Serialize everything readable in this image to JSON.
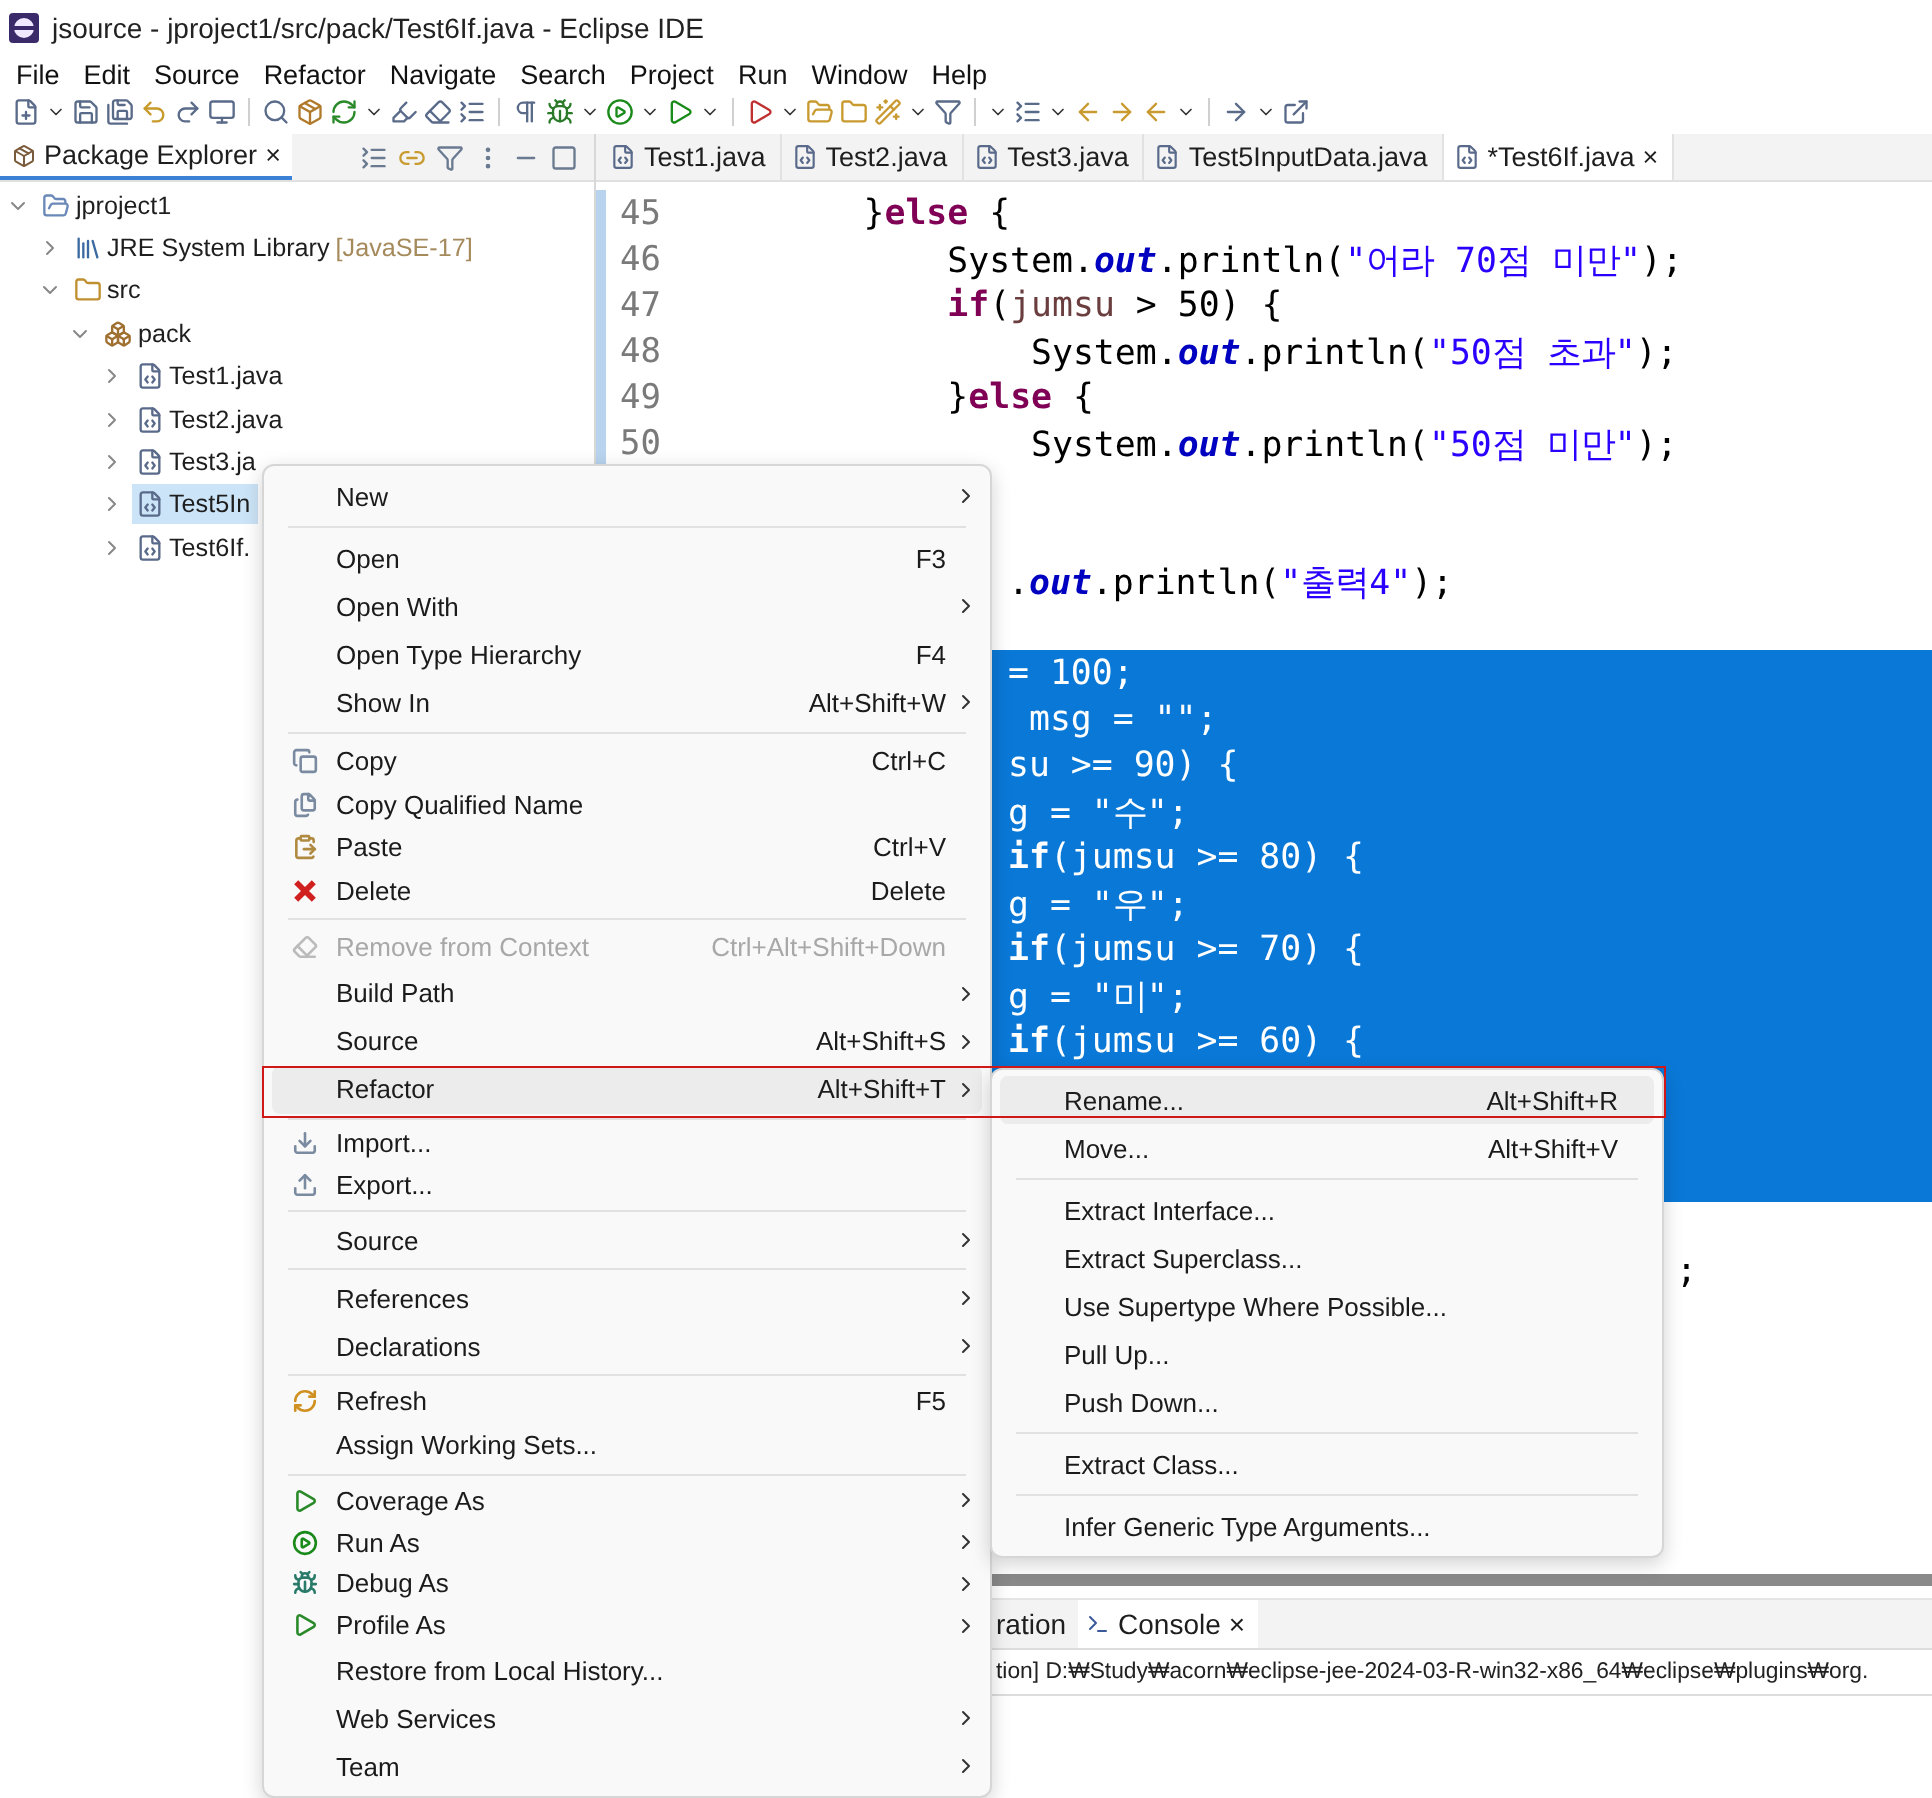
{
  "window": {
    "title": "jsource - jproject1/src/pack/Test6If.java - Eclipse IDE"
  },
  "menu_bar": [
    "File",
    "Edit",
    "Source",
    "Refactor",
    "Navigate",
    "Search",
    "Project",
    "Run",
    "Window",
    "Help"
  ],
  "package_explorer": {
    "title": "Package Explorer",
    "close": "×",
    "tree": [
      {
        "kind": "project",
        "label": "jproject1",
        "expanded": true,
        "selected": false,
        "children": [
          {
            "kind": "library",
            "label": "JRE System Library",
            "decoration": "[JavaSE-17]",
            "expanded": false,
            "selected": false
          },
          {
            "kind": "source-folder",
            "label": "src",
            "expanded": true,
            "selected": false,
            "children": [
              {
                "kind": "package",
                "label": "pack",
                "expanded": true,
                "selected": false,
                "children": [
                  {
                    "kind": "file",
                    "label": "Test1.java",
                    "expanded": false,
                    "selected": false
                  },
                  {
                    "kind": "file",
                    "label": "Test2.java",
                    "expanded": false,
                    "selected": false
                  },
                  {
                    "kind": "file",
                    "label": "Test3.ja",
                    "expanded": false,
                    "selected": false
                  },
                  {
                    "kind": "file",
                    "label": "Test5In",
                    "expanded": false,
                    "selected": true
                  },
                  {
                    "kind": "file",
                    "label": "Test6If.",
                    "expanded": false,
                    "selected": false
                  }
                ]
              }
            ]
          }
        ]
      }
    ]
  },
  "editor": {
    "tabs": [
      {
        "label": "Test1.java",
        "selected": false
      },
      {
        "label": "Test2.java",
        "selected": false
      },
      {
        "label": "Test3.java",
        "selected": false
      },
      {
        "label": "Test5InputData.java",
        "selected": false
      },
      {
        "label": "*Test6If.java",
        "selected": true,
        "close": "×"
      }
    ],
    "lines": [
      {
        "kind": "full",
        "number": "45",
        "selected": false,
        "tokens": [
          {
            "kind": "plain",
            "text": "        }"
          },
          {
            "kind": "keyword",
            "text": "else"
          },
          {
            "kind": "plain",
            "text": " {"
          }
        ]
      },
      {
        "kind": "full",
        "number": "46",
        "selected": false,
        "tokens": [
          {
            "kind": "plain",
            "text": "            System."
          },
          {
            "kind": "field",
            "text": "out"
          },
          {
            "kind": "plain",
            "text": ".println("
          },
          {
            "kind": "string",
            "text": "\"어라 70점 미만\""
          },
          {
            "kind": "plain",
            "text": ");"
          }
        ]
      },
      {
        "kind": "full",
        "number": "47",
        "selected": false,
        "tokens": [
          {
            "kind": "keyword",
            "text": "            if"
          },
          {
            "kind": "plain",
            "text": "("
          },
          {
            "kind": "local",
            "text": "jumsu"
          },
          {
            "kind": "plain",
            "text": " > 50) {"
          }
        ]
      },
      {
        "kind": "full",
        "number": "48",
        "selected": false,
        "tokens": [
          {
            "kind": "plain",
            "text": "                System."
          },
          {
            "kind": "field",
            "text": "out"
          },
          {
            "kind": "plain",
            "text": ".println("
          },
          {
            "kind": "string",
            "text": "\"50점 초과\""
          },
          {
            "kind": "plain",
            "text": ");"
          }
        ]
      },
      {
        "kind": "full",
        "number": "49",
        "selected": false,
        "tokens": [
          {
            "kind": "plain",
            "text": "            }"
          },
          {
            "kind": "keyword",
            "text": "else"
          },
          {
            "kind": "plain",
            "text": " {"
          }
        ]
      },
      {
        "kind": "full",
        "number": "50",
        "selected": false,
        "tokens": [
          {
            "kind": "plain",
            "text": "                System."
          },
          {
            "kind": "field",
            "text": "out"
          },
          {
            "kind": "plain",
            "text": ".println("
          },
          {
            "kind": "string",
            "text": "\"50점 미만\""
          },
          {
            "kind": "plain",
            "text": ");"
          }
        ]
      },
      {
        "kind": "blank",
        "selected": false
      },
      {
        "kind": "blank",
        "selected": false
      },
      {
        "kind": "after-menu",
        "selected": false,
        "tokens": [
          {
            "kind": "plain",
            "text": "."
          },
          {
            "kind": "field",
            "text": "out"
          },
          {
            "kind": "plain",
            "text": ".println("
          },
          {
            "kind": "string",
            "text": "\"출력4\""
          },
          {
            "kind": "plain",
            "text": ");"
          }
        ]
      },
      {
        "kind": "blank",
        "selected": false
      },
      {
        "kind": "after-menu",
        "selected": true,
        "tokens": [
          {
            "kind": "plain",
            "text": "= 100;"
          }
        ]
      },
      {
        "kind": "after-menu",
        "selected": true,
        "tokens": [
          {
            "kind": "plain",
            "text": " msg = \"\";"
          }
        ]
      },
      {
        "kind": "after-menu",
        "selected": true,
        "tokens": [
          {
            "kind": "plain",
            "text": "su >= 90) {"
          }
        ]
      },
      {
        "kind": "after-menu",
        "selected": true,
        "tokens": [
          {
            "kind": "plain",
            "text": "g = \"수\";"
          }
        ]
      },
      {
        "kind": "after-menu",
        "selected": true,
        "tokens": [
          {
            "kind": "keyword",
            "text": "if"
          },
          {
            "kind": "plain",
            "text": "(jumsu >= 80) {"
          }
        ]
      },
      {
        "kind": "after-menu",
        "selected": true,
        "tokens": [
          {
            "kind": "plain",
            "text": "g = \"우\";"
          }
        ]
      },
      {
        "kind": "after-menu",
        "selected": true,
        "tokens": [
          {
            "kind": "keyword",
            "text": "if"
          },
          {
            "kind": "plain",
            "text": "(jumsu >= 70) {"
          }
        ]
      },
      {
        "kind": "after-menu",
        "selected": true,
        "tokens": [
          {
            "kind": "plain",
            "text": "g = \"미\";"
          }
        ]
      },
      {
        "kind": "after-menu",
        "selected": true,
        "tokens": [
          {
            "kind": "keyword",
            "text": "if"
          },
          {
            "kind": "plain",
            "text": "(jumsu >= 60) {"
          }
        ]
      },
      {
        "kind": "blank",
        "selected": true
      },
      {
        "kind": "blank",
        "selected": true
      },
      {
        "kind": "blank",
        "selected": true
      },
      {
        "kind": "blank",
        "selected": false
      },
      {
        "kind": "after-submenu",
        "selected": false,
        "tokens": [
          {
            "kind": "plain",
            "text": ";"
          }
        ]
      },
      {
        "kind": "blank",
        "selected": false
      },
      {
        "kind": "blank",
        "selected": false
      },
      {
        "kind": "blank",
        "selected": false
      },
      {
        "kind": "blank",
        "selected": false
      },
      {
        "kind": "blank",
        "selected": false
      },
      {
        "kind": "blank",
        "selected": false
      }
    ]
  },
  "console": {
    "tabs": [
      {
        "label": "ration",
        "selected": false
      },
      {
        "label": "Console",
        "selected": true,
        "close": "×"
      }
    ],
    "output": "tion] D:₩Study₩acorn₩eclipse-jee-2024-03-R-win32-x86_64₩eclipse₩plugins₩org."
  },
  "context_menu": {
    "items": [
      {
        "kind": "item",
        "label": "New",
        "submenu": true,
        "selected": false,
        "disabled": false
      },
      {
        "kind": "separator"
      },
      {
        "kind": "item",
        "label": "Open",
        "shortcut": "F3",
        "submenu": false,
        "selected": false,
        "disabled": false
      },
      {
        "kind": "item",
        "label": "Open With",
        "submenu": true,
        "selected": false,
        "disabled": false
      },
      {
        "kind": "item",
        "label": "Open Type Hierarchy",
        "shortcut": "F4",
        "submenu": false,
        "selected": false,
        "disabled": false
      },
      {
        "kind": "item",
        "label": "Show In",
        "shortcut": "Alt+Shift+W",
        "submenu": true,
        "selected": false,
        "disabled": false
      },
      {
        "kind": "separator"
      },
      {
        "kind": "item",
        "label": "Copy",
        "shortcut": "Ctrl+C",
        "submenu": false,
        "selected": false,
        "disabled": false
      },
      {
        "kind": "item",
        "label": "Copy Qualified Name",
        "submenu": false,
        "selected": false,
        "disabled": false
      },
      {
        "kind": "item",
        "label": "Paste",
        "shortcut": "Ctrl+V",
        "submenu": false,
        "selected": false,
        "disabled": false
      },
      {
        "kind": "item",
        "label": "Delete",
        "shortcut": "Delete",
        "submenu": false,
        "selected": false,
        "disabled": false
      },
      {
        "kind": "separator"
      },
      {
        "kind": "item",
        "label": "Remove from Context",
        "shortcut": "Ctrl+Alt+Shift+Down",
        "submenu": false,
        "selected": false,
        "disabled": true
      },
      {
        "kind": "item",
        "label": "Build Path",
        "submenu": true,
        "selected": false,
        "disabled": false
      },
      {
        "kind": "item",
        "label": "Source",
        "shortcut": "Alt+Shift+S",
        "submenu": true,
        "selected": false,
        "disabled": false
      },
      {
        "kind": "item",
        "label": "Refactor",
        "shortcut": "Alt+Shift+T",
        "submenu": true,
        "selected": true,
        "disabled": false
      },
      {
        "kind": "separator"
      },
      {
        "kind": "item",
        "label": "Import...",
        "submenu": false,
        "selected": false,
        "disabled": false
      },
      {
        "kind": "item",
        "label": "Export...",
        "submenu": false,
        "selected": false,
        "disabled": false
      },
      {
        "kind": "separator"
      },
      {
        "kind": "item",
        "label": "Source",
        "submenu": true,
        "selected": false,
        "disabled": false
      },
      {
        "kind": "separator"
      },
      {
        "kind": "item",
        "label": "References",
        "submenu": true,
        "selected": false,
        "disabled": false
      },
      {
        "kind": "item",
        "label": "Declarations",
        "submenu": true,
        "selected": false,
        "disabled": false
      },
      {
        "kind": "separator"
      },
      {
        "kind": "item",
        "label": "Refresh",
        "shortcut": "F5",
        "submenu": false,
        "selected": false,
        "disabled": false
      },
      {
        "kind": "item",
        "label": "Assign Working Sets...",
        "submenu": false,
        "selected": false,
        "disabled": false
      },
      {
        "kind": "separator"
      },
      {
        "kind": "item",
        "label": "Coverage As",
        "submenu": true,
        "selected": false,
        "disabled": false
      },
      {
        "kind": "item",
        "label": "Run As",
        "submenu": true,
        "selected": false,
        "disabled": false
      },
      {
        "kind": "item",
        "label": "Debug As",
        "submenu": true,
        "selected": false,
        "disabled": false
      },
      {
        "kind": "item",
        "label": "Profile As",
        "submenu": true,
        "selected": false,
        "disabled": false
      },
      {
        "kind": "item",
        "label": "Restore from Local History...",
        "submenu": false,
        "selected": false,
        "disabled": false
      },
      {
        "kind": "item",
        "label": "Web Services",
        "submenu": true,
        "selected": false,
        "disabled": false
      },
      {
        "kind": "item",
        "label": "Team",
        "submenu": true,
        "selected": false,
        "disabled": false
      }
    ]
  },
  "refactor_submenu": {
    "items": [
      {
        "kind": "item",
        "label": "Rename...",
        "shortcut": "Alt+Shift+R",
        "selected": true
      },
      {
        "kind": "item",
        "label": "Move...",
        "shortcut": "Alt+Shift+V",
        "selected": false
      },
      {
        "kind": "separator"
      },
      {
        "kind": "item",
        "label": "Extract Interface...",
        "selected": false
      },
      {
        "kind": "item",
        "label": "Extract Superclass...",
        "selected": false
      },
      {
        "kind": "item",
        "label": "Use Supertype Where Possible...",
        "selected": false
      },
      {
        "kind": "item",
        "label": "Pull Up...",
        "selected": false
      },
      {
        "kind": "item",
        "label": "Push Down...",
        "selected": false
      },
      {
        "kind": "separator"
      },
      {
        "kind": "item",
        "label": "Extract Class...",
        "selected": false
      },
      {
        "kind": "separator"
      },
      {
        "kind": "item",
        "label": "Infer Generic Type Arguments...",
        "selected": false
      }
    ]
  }
}
